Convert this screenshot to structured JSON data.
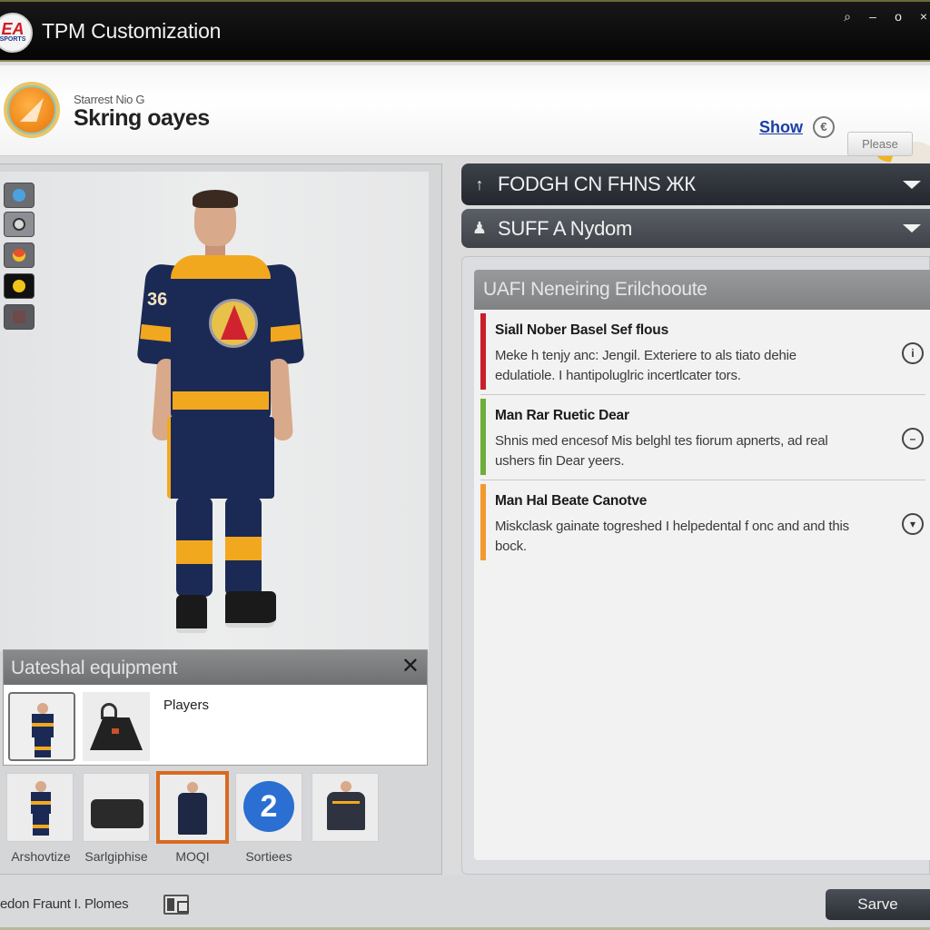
{
  "window": {
    "title": "TPM Customization",
    "logo_text": "EA",
    "logo_subtext": "SPORTS",
    "controls": {
      "search": "search-icon",
      "minimize": "–",
      "maximize": "o",
      "close": "×"
    }
  },
  "header": {
    "subtitle": "Starrest Nio G",
    "title": "Skring oayes",
    "show_link": "Show",
    "show_icon_glyph": "€",
    "please_button": "Please"
  },
  "tools": [
    {
      "name": "tool-apps",
      "color": "#4aa3df"
    },
    {
      "name": "tool-camera",
      "color": "#bdbdbd"
    },
    {
      "name": "tool-palette",
      "color": "#e8502e"
    },
    {
      "name": "tool-emblem",
      "color": "#f0c419"
    },
    {
      "name": "tool-grid",
      "color": "#7a5050"
    }
  ],
  "player": {
    "number": "36",
    "colors": {
      "primary": "#1b2a55",
      "accent": "#f2a81e"
    }
  },
  "equipment_panel": {
    "title": "Uateshal equipment",
    "close_glyph": "✕",
    "label": "Players"
  },
  "thumbnails": [
    {
      "label": "Arshovtize",
      "type": "player-full",
      "selected": false
    },
    {
      "label": "Sarlgiphise",
      "type": "bag",
      "selected": false
    },
    {
      "label": "MOQI",
      "type": "jacket",
      "selected": true
    },
    {
      "label": "Sortiees",
      "type": "helmet",
      "badge": "2",
      "selected": false
    },
    {
      "label": "",
      "type": "sweater",
      "selected": false
    }
  ],
  "dropdowns": [
    {
      "icon": "↑",
      "label": "FODGH CN FHNS ЖК"
    },
    {
      "icon": "person-icon",
      "label": "SUFF A Nydom"
    }
  ],
  "info_panel": {
    "title": "UAFI Neneiring Erilchooute",
    "notices": [
      {
        "title": "Siall Nober Basel Sef flous",
        "body": "Meke h tenjy anc: Jengil. Exteriere to als tiato dehie edulatiole. I hantipoluglric incertlcater tors.",
        "color": "#c8202a",
        "icon": "info-icon",
        "glyph": "i"
      },
      {
        "title": "Man Rar Ruetic Dear",
        "body": "Shnis med encesof Mis belghl tes fiorum apnerts, ad real ushers fin Dear yeers.",
        "color": "#6fae3a",
        "icon": "minus-circle-icon",
        "glyph": "–"
      },
      {
        "title": "Man Hal Beate Canotve",
        "body": "Miskclask gainate togreshed I helpedental f onc and and this bock.",
        "color": "#f29a2e",
        "icon": "chevron-down-circle-icon",
        "glyph": "▾"
      }
    ]
  },
  "footer": {
    "status": "edon Fraunt I. Plomes",
    "save_button": "Sarve"
  }
}
